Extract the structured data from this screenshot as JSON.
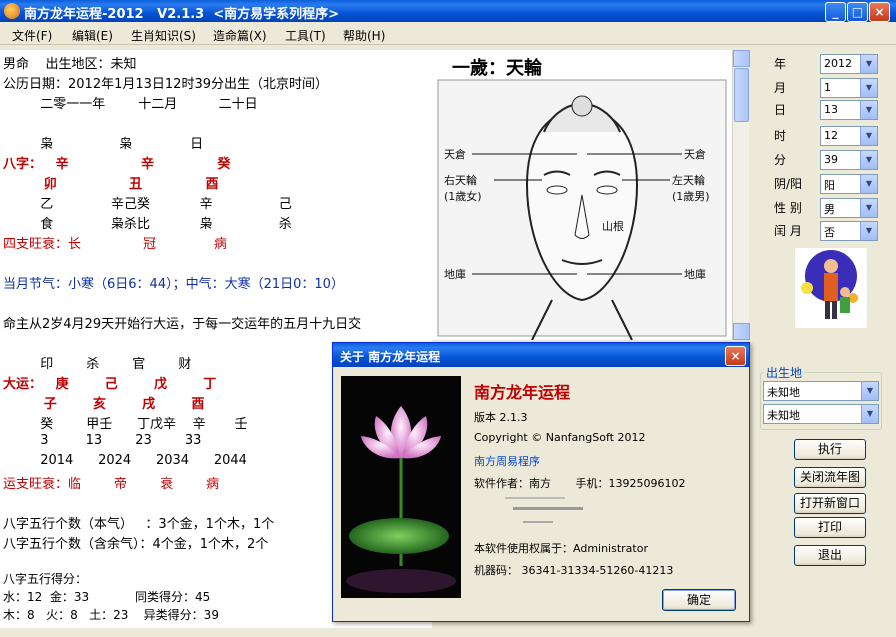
{
  "window": {
    "title": "南方龙年运程-2012   V2.1.3  <南方易学系列程序>"
  },
  "menu": [
    {
      "label": "文件(F)"
    },
    {
      "label": "编辑(E)"
    },
    {
      "label": "生肖知识(S)"
    },
    {
      "label": "造命篇(X)"
    },
    {
      "label": "工具(T)"
    },
    {
      "label": "帮助(H)"
    }
  ],
  "main": {
    "lines": [
      "男命    出生地区：未知",
      "公历日期：2012年1月13日12时39分出生（北京时间）",
      "         二零一一年        十二月          二十日",
      "         枭                枭              日",
      "八字：   辛                辛              癸",
      "         卯                丑              酉",
      "         乙              辛己癸            辛                己",
      "         食              枭杀比            枭                杀",
      "四支旺衰：长               冠              病",
      "当月节气：小寒（6日6：44）；中气：大寒（21日0：10）",
      "命主从2岁4月29天开始行大运，于每一交运年的五月十九日交",
      "         印        杀        官        财",
      "大运：   庚        己        戊        丁",
      "         子        亥        戌        酉",
      "         癸        甲壬      丁戊辛    辛       壬",
      "         3         13        23        33",
      "         2014      2024      2034      2044",
      "运支旺衰：临        帝        衰        病",
      "八字五行个数（本气）   ：3个金，1个木，1个",
      "八字五行个数（含余气）：4个金，1个木，2个",
      "八字五行得分：",
      "水：12  金：33            同类得分：45",
      "木：8   火：8   土：23    异类得分：39"
    ]
  },
  "face": {
    "title": "一歲：天輪",
    "labels": [
      "天倉",
      "天倉",
      "右天輪",
      "(1歲女)",
      "左天輪",
      "(1歲男)",
      "山根",
      "地庫",
      "地庫"
    ]
  },
  "form": {
    "year_label": "年",
    "year": "2012",
    "month_label": "月",
    "month": "1",
    "day_label": "日",
    "day": "13",
    "hour_label": "时",
    "hour": "12",
    "minute_label": "分",
    "minute": "39",
    "calendar_label": "阴/阳",
    "calendar": "阳",
    "gender_label": "性 别",
    "gender": "男",
    "leap_label": "闰 月",
    "leap": "否"
  },
  "birthplace": {
    "label": "出生地",
    "province": "未知地",
    "city": "未知地"
  },
  "actions": {
    "run": "执行",
    "close_chart": "关闭流年图",
    "new_window": "打开新窗口",
    "print": "打印",
    "exit": "退出"
  },
  "dialog": {
    "title": "关于 南方龙年运程",
    "app_name": "南方龙年运程",
    "version": "版本 2.1.3",
    "copyright": "Copyright © NanfangSoft 2012",
    "series": "南方周易程序",
    "author_line": "软件作者：南方       手机：13925096102",
    "license_line": "本软件使用权属于：Administrator",
    "machine_line": "机器码： 36341-31334-51260-41213",
    "ok": "确定"
  },
  "colors": {
    "accent_red": "#c00000",
    "title_blue": "#0554d6",
    "text_blue": "#1030a0"
  }
}
